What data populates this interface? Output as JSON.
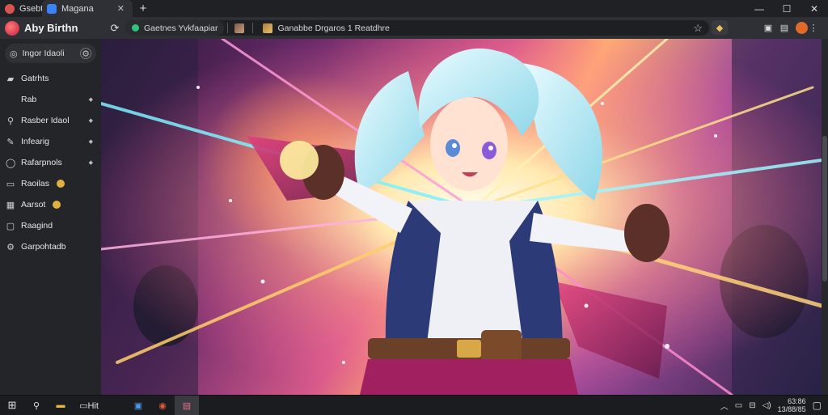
{
  "tabs": [
    {
      "label": "Gsebtan",
      "active": false,
      "favicon_color": "#d9534f"
    },
    {
      "label": "Magana",
      "active": true,
      "favicon_color": "#3b82f6"
    }
  ],
  "newtab_symbol": "+",
  "window_controls": {
    "minimize": "—",
    "maximize": "☐",
    "close": "✕"
  },
  "brand": {
    "name": "Aby Birthn"
  },
  "address_bar": {
    "security_chip": "Gaetnes Yvkfaapiar",
    "page_title": "Ganabbe Drgaros 1 Reatdhre"
  },
  "sidebar": {
    "search_placeholder": "Ingor Idaoli",
    "items": [
      {
        "icon": "folder-icon",
        "glyph": "▰",
        "label": "Gatrhts",
        "caret": false,
        "coin": false
      },
      {
        "icon": "none",
        "glyph": "",
        "label": "Rab",
        "caret": true,
        "coin": false
      },
      {
        "icon": "link-icon",
        "glyph": "⚲",
        "label": "Rasber Idaol",
        "caret": true,
        "coin": false
      },
      {
        "icon": "brush-icon",
        "glyph": "✎",
        "label": "Infearig",
        "caret": true,
        "coin": false
      },
      {
        "icon": "circle-icon",
        "glyph": "◯",
        "label": "Rafarpnols",
        "caret": true,
        "coin": false
      },
      {
        "icon": "book-icon",
        "glyph": "▭",
        "label": "Raoilas",
        "caret": false,
        "coin": true
      },
      {
        "icon": "grid-icon",
        "glyph": "▦",
        "label": "Aarsot",
        "caret": false,
        "coin": true
      },
      {
        "icon": "image-icon",
        "glyph": "▢",
        "label": "Raagind",
        "caret": false,
        "coin": false
      },
      {
        "icon": "settings-icon",
        "glyph": "⚙",
        "label": "Garpohtadb",
        "caret": false,
        "coin": false
      }
    ]
  },
  "taskbar": {
    "items": [
      {
        "name": "start-button",
        "glyph": "⊞"
      },
      {
        "name": "search-icon",
        "glyph": "⚲"
      },
      {
        "name": "file-explorer-icon",
        "glyph": "▬"
      },
      {
        "name": "apps-label",
        "glyph": "▭Hit"
      },
      {
        "name": "store-icon",
        "glyph": "▣"
      },
      {
        "name": "browser-icon",
        "glyph": "◉"
      },
      {
        "name": "active-app-icon",
        "glyph": "▤"
      }
    ],
    "clock_time": "63:86",
    "clock_date": "13/88/85"
  },
  "colors": {
    "accent": "#2ec27e",
    "tab_active_bg": "#2e3035",
    "sidebar_bg": "#242529"
  }
}
